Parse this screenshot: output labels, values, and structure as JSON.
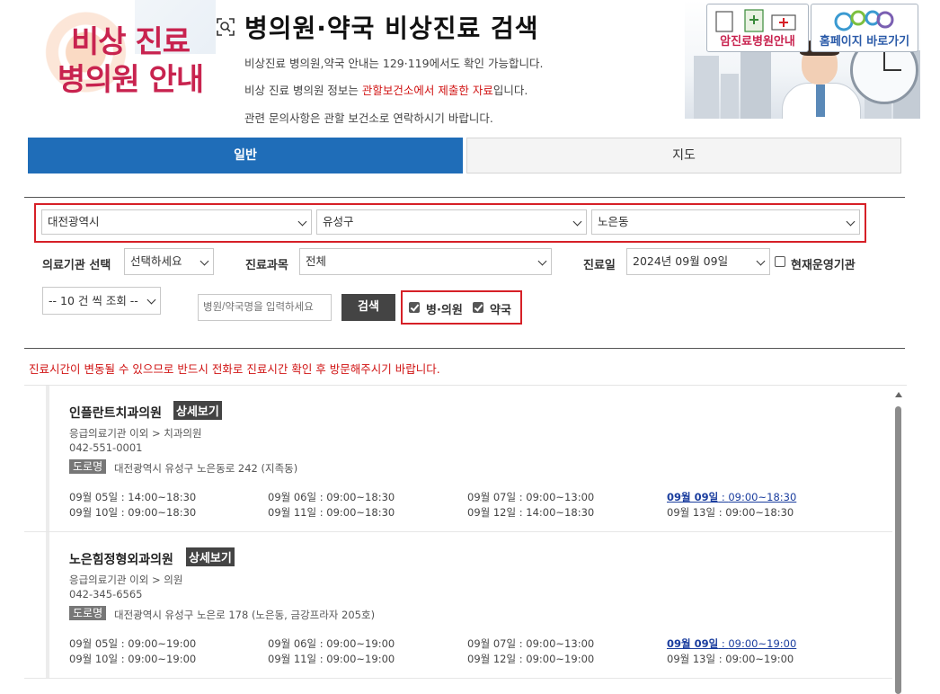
{
  "header": {
    "logo_line1": "비상 진료",
    "logo_line2": "병의원 안내",
    "title": "병의원·약국 비상진료 검색",
    "info1": "비상진료 병의원,약국 안내는 129·119에서도 확인 가능합니다.",
    "info2_pre": "비상 진료 병의원 정보는 ",
    "info2_highlight": "관할보건소에서 제출한 자료",
    "info2_post": "입니다.",
    "info3": "관련 문의사항은 관할 보건소로 연락하시기 바랍니다."
  },
  "banner": {
    "cancer_label": "암진료병원안내",
    "homepage_label": "홈페이지 바로가기"
  },
  "tabs": {
    "general": "일반",
    "map": "지도"
  },
  "filters": {
    "city": "대전광역시",
    "district": "유성구",
    "dong": "노은동",
    "institution_label": "의료기관 선택",
    "institution_value": "선택하세요",
    "department_label": "진료과목",
    "department_value": "전체",
    "date_label": "진료일",
    "date_value": "2024년 09월 09일",
    "open_now_label": "현재운영기관",
    "open_now_checked": false,
    "page_size": "-- 10 건 씩 조회 --",
    "search_placeholder": "병원/약국명을 입력하세요",
    "search_button": "검색",
    "hospital_label": "병·의원",
    "hospital_checked": true,
    "pharmacy_label": "약국",
    "pharmacy_checked": true
  },
  "notice": "진료시간이 변동될 수 있으므로 반드시 전화로 진료시간 확인 후 방문해주시기 바랍니다.",
  "results": [
    {
      "name": "인플란트치과의원",
      "detail": "상세보기",
      "category": "응급의료기관 이외 > 치과의원",
      "phone": "042-551-0001",
      "road_tag": "도로명",
      "address": "대전광역시 유성구 노은동로 242 (지족동)",
      "hours": [
        {
          "day": "09월 05일",
          "time": "14:00~18:30",
          "today": false
        },
        {
          "day": "09월 06일",
          "time": "09:00~18:30",
          "today": false
        },
        {
          "day": "09월 07일",
          "time": "09:00~13:00",
          "today": false
        },
        {
          "day": "09월 09일",
          "time": "09:00~18:30",
          "today": true
        },
        {
          "day": "09월 10일",
          "time": "09:00~18:30",
          "today": false
        },
        {
          "day": "09월 11일",
          "time": "09:00~18:30",
          "today": false
        },
        {
          "day": "09월 12일",
          "time": "14:00~18:30",
          "today": false
        },
        {
          "day": "09월 13일",
          "time": "09:00~18:30",
          "today": false
        }
      ]
    },
    {
      "name": "노은힘정형외과의원",
      "detail": "상세보기",
      "category": "응급의료기관 이외 > 의원",
      "phone": "042-345-6565",
      "road_tag": "도로명",
      "address": "대전광역시 유성구 노은로 178 (노은동, 금강프라자 205호)",
      "hours": [
        {
          "day": "09월 05일",
          "time": "09:00~19:00",
          "today": false
        },
        {
          "day": "09월 06일",
          "time": "09:00~19:00",
          "today": false
        },
        {
          "day": "09월 07일",
          "time": "09:00~13:00",
          "today": false
        },
        {
          "day": "09월 09일",
          "time": "09:00~19:00",
          "today": true
        },
        {
          "day": "09월 10일",
          "time": "09:00~19:00",
          "today": false
        },
        {
          "day": "09월 11일",
          "time": "09:00~19:00",
          "today": false
        },
        {
          "day": "09월 12일",
          "time": "09:00~19:00",
          "today": false
        },
        {
          "day": "09월 13일",
          "time": "09:00~19:00",
          "today": false
        }
      ]
    }
  ],
  "colors": {
    "brand_blue": "#1f6db8",
    "logo_red": "#c8234f",
    "alert_red": "#d01313",
    "link_blue": "#1a3d9e"
  }
}
